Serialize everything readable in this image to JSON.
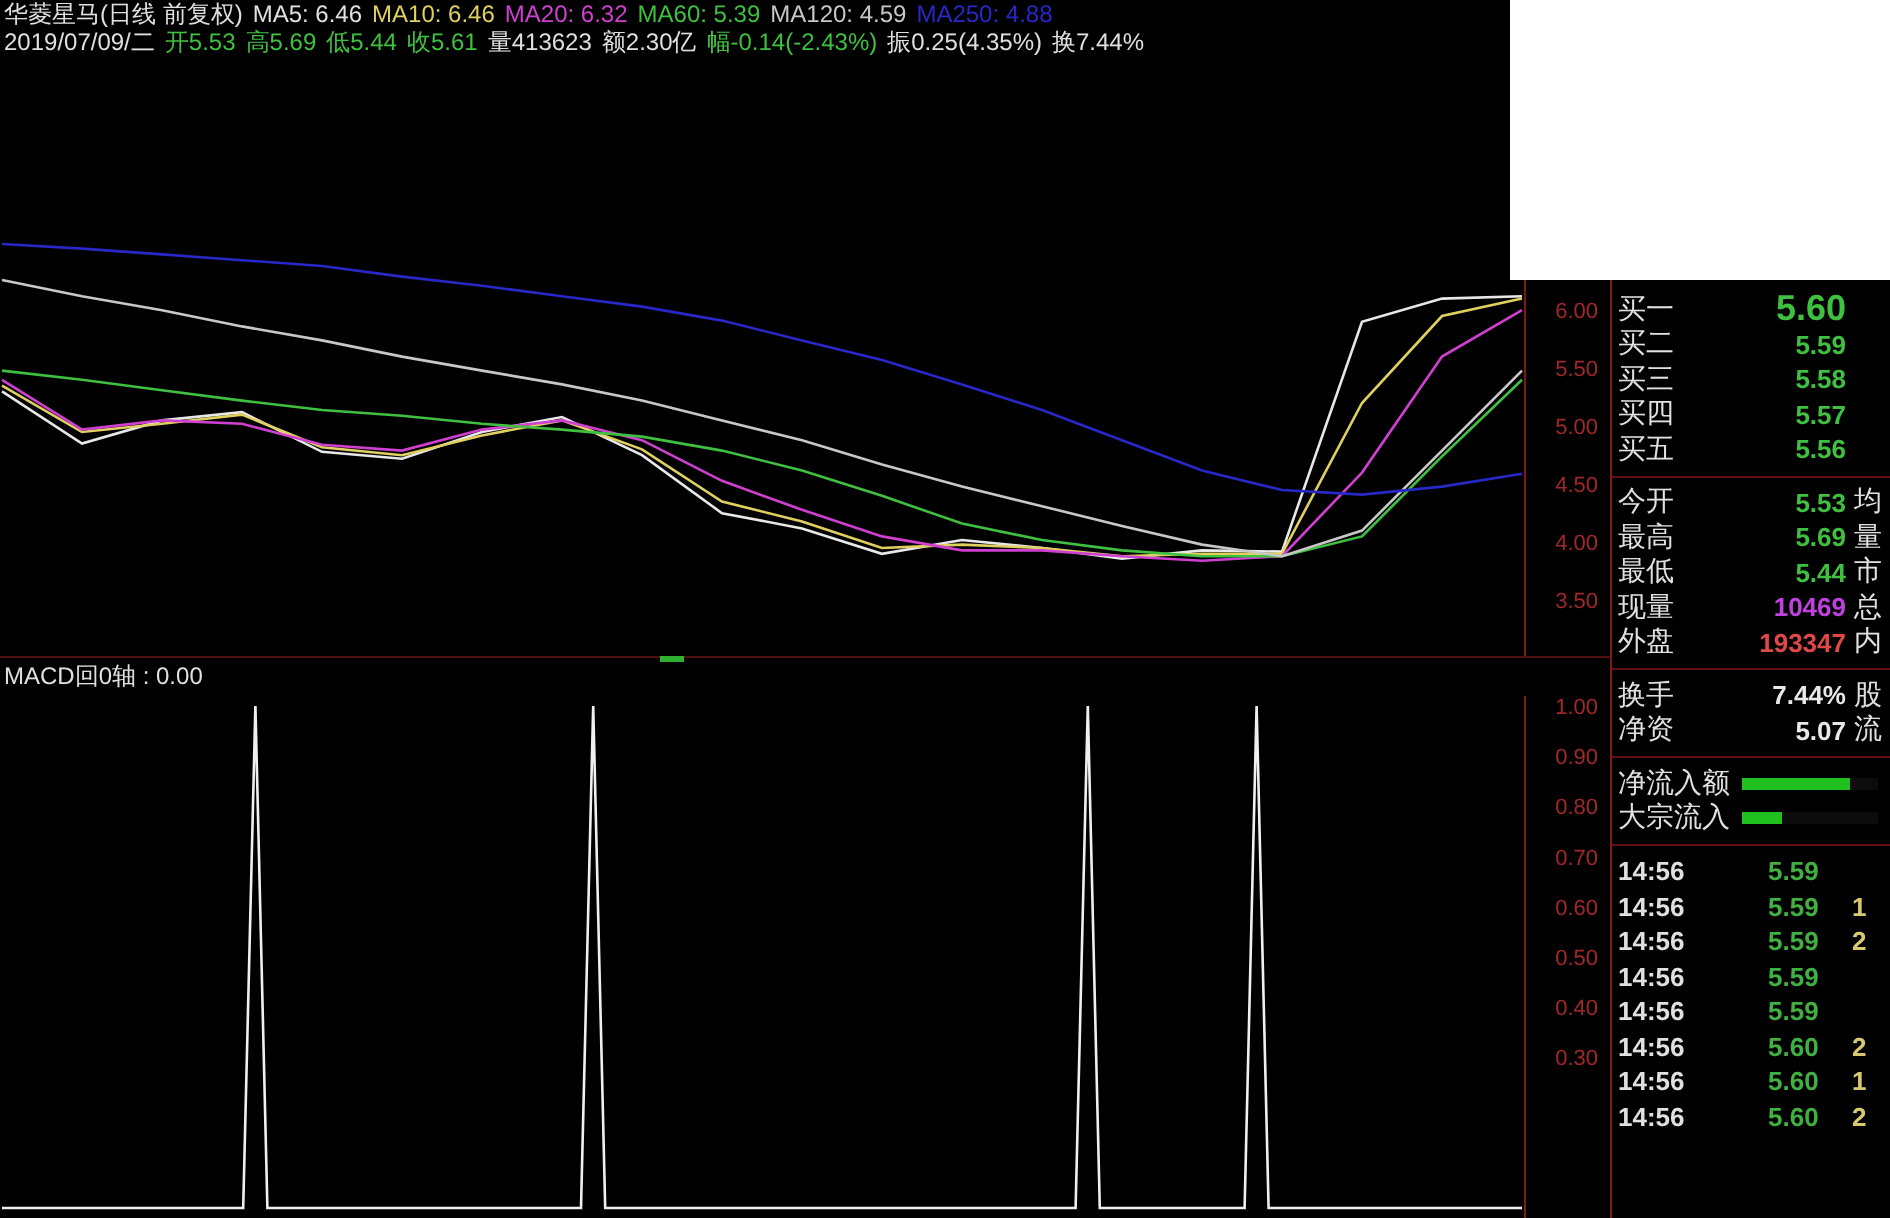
{
  "header": {
    "line1": [
      {
        "text": "华菱星马(日线 前复权)",
        "color": "#e0e0e0"
      },
      {
        "text": "MA5: 6.46",
        "color": "#e0e0e0"
      },
      {
        "text": "MA10: 6.46",
        "color": "#e0d060"
      },
      {
        "text": "MA20: 6.32",
        "color": "#d040d0"
      },
      {
        "text": "MA60: 5.39",
        "color": "#40c040"
      },
      {
        "text": "MA120: 4.59",
        "color": "#c8c8c8"
      },
      {
        "text": "MA250: 4.88",
        "color": "#2828c8"
      }
    ],
    "line2": [
      {
        "text": "2019/07/09/二",
        "color": "#e0e0e0"
      },
      {
        "text": "开5.53",
        "color": "#40c040"
      },
      {
        "text": "高5.69",
        "color": "#40c040"
      },
      {
        "text": "低5.44",
        "color": "#40c040"
      },
      {
        "text": "收5.61",
        "color": "#40c040"
      },
      {
        "text": "量413623",
        "color": "#e0e0e0"
      },
      {
        "text": "额2.30亿",
        "color": "#e0e0e0"
      },
      {
        "text": "幅-0.14(-2.43%)",
        "color": "#40c040"
      },
      {
        "text": "振0.25(4.35%)",
        "color": "#e0e0e0"
      },
      {
        "text": "换7.44%",
        "color": "#e0e0e0"
      }
    ]
  },
  "price_chart": {
    "chart_data": {
      "type": "line",
      "ylim": [
        3.02,
        8.19
      ],
      "yticks": [
        {
          "value": 3.5,
          "label": "3.50"
        },
        {
          "value": 4,
          "label": "4.00"
        },
        {
          "value": 4.5,
          "label": "4.50"
        },
        {
          "value": 5,
          "label": "5.00"
        },
        {
          "value": 5.5,
          "label": "5.50"
        },
        {
          "value": 6,
          "label": "6.00"
        }
      ],
      "series": [
        {
          "color": "#e8e8e8",
          "values": [
            5.3,
            4.85,
            5.05,
            5.12,
            4.78,
            4.72,
            4.95,
            5.08,
            4.75,
            4.25,
            4.12,
            3.9,
            4.02,
            3.95,
            3.86,
            3.93,
            3.92,
            5.9,
            6.1,
            6.12
          ]
        },
        {
          "color": "#e0d060",
          "values": [
            5.35,
            4.95,
            5.02,
            5.1,
            4.82,
            4.75,
            4.92,
            5.05,
            4.8,
            4.35,
            4.18,
            3.95,
            3.98,
            3.95,
            3.88,
            3.9,
            3.9,
            5.2,
            5.95,
            6.1
          ]
        },
        {
          "color": "#d040d0",
          "values": [
            5.4,
            4.97,
            5.05,
            5.02,
            4.84,
            4.79,
            4.97,
            5.05,
            4.88,
            4.53,
            4.28,
            4.05,
            3.93,
            3.93,
            3.88,
            3.84,
            3.88,
            4.6,
            5.6,
            6.0
          ]
        },
        {
          "color": "#40c040",
          "values": [
            5.48,
            5.4,
            5.31,
            5.22,
            5.14,
            5.09,
            5.02,
            4.97,
            4.91,
            4.79,
            4.62,
            4.4,
            4.16,
            4.02,
            3.93,
            3.88,
            3.88,
            4.05,
            4.74,
            5.4
          ]
        },
        {
          "color": "#c8c8c8",
          "values": [
            6.26,
            6.12,
            6.0,
            5.86,
            5.74,
            5.6,
            5.48,
            5.36,
            5.22,
            5.05,
            4.88,
            4.67,
            4.48,
            4.31,
            4.14,
            3.98,
            3.88,
            4.1,
            4.79,
            5.48
          ]
        },
        {
          "color": "#2828c8",
          "values": [
            6.57,
            6.53,
            6.48,
            6.43,
            6.38,
            6.29,
            6.21,
            6.12,
            6.03,
            5.91,
            5.74,
            5.57,
            5.36,
            5.14,
            4.88,
            4.62,
            4.45,
            4.41,
            4.48,
            4.59
          ]
        }
      ]
    }
  },
  "macd": {
    "title": "MACD回0轴 : 0.00",
    "chart_data": {
      "type": "line",
      "ylim": [
        -0.02,
        1.02
      ],
      "yticks": [
        {
          "value": 0.3,
          "label": "0.30"
        },
        {
          "value": 0.4,
          "label": "0.40"
        },
        {
          "value": 0.5,
          "label": "0.50"
        },
        {
          "value": 0.6,
          "label": "0.60"
        },
        {
          "value": 0.7,
          "label": "0.70"
        },
        {
          "value": 0.8,
          "label": "0.80"
        },
        {
          "value": 0.9,
          "label": "0.90"
        },
        {
          "value": 1,
          "label": "1.00"
        }
      ],
      "series": [
        {
          "color": "#f0f0f0",
          "values": [
            0,
            0,
            0,
            0,
            0,
            0,
            0,
            0,
            0,
            0,
            0,
            0,
            0,
            0,
            0,
            0,
            0,
            0,
            0,
            0,
            0,
            1,
            0,
            0,
            0,
            0,
            0,
            0,
            0,
            0,
            0,
            0,
            0,
            0,
            0,
            0,
            0,
            0,
            0,
            0,
            0,
            0,
            0,
            0,
            0,
            0,
            0,
            0,
            0,
            1,
            0,
            0,
            0,
            0,
            0,
            0,
            0,
            0,
            0,
            0,
            0,
            0,
            0,
            0,
            0,
            0,
            0,
            0,
            0,
            0,
            0,
            0,
            0,
            0,
            0,
            0,
            0,
            0,
            0,
            0,
            0,
            0,
            0,
            0,
            0,
            0,
            0,
            0,
            0,
            0,
            1,
            0,
            0,
            0,
            0,
            0,
            0,
            0,
            0,
            0,
            0,
            0,
            0,
            0,
            1,
            0,
            0,
            0,
            0,
            0,
            0,
            0,
            0,
            0,
            0,
            0,
            0,
            0,
            0,
            0,
            0,
            0,
            0,
            0,
            0,
            0,
            0
          ]
        }
      ]
    }
  },
  "order_book": [
    {
      "label": "买一",
      "price": "5.60"
    },
    {
      "label": "买二",
      "price": "5.59"
    },
    {
      "label": "买三",
      "price": "5.58"
    },
    {
      "label": "买四",
      "price": "5.57"
    },
    {
      "label": "买五",
      "price": "5.56"
    }
  ],
  "quote": [
    {
      "label": "今开",
      "value": "5.53",
      "color": "#40c040",
      "label2": "均"
    },
    {
      "label": "最高",
      "value": "5.69",
      "color": "#40c040",
      "label2": "量"
    },
    {
      "label": "最低",
      "value": "5.44",
      "color": "#40c040",
      "label2": "市"
    },
    {
      "label": "现量",
      "value": "10469",
      "color": "#c040e0",
      "label2": "总"
    },
    {
      "label": "外盘",
      "value": "193347",
      "color": "#e04848",
      "label2": "内"
    }
  ],
  "shares": [
    {
      "label": "换手",
      "value": "7.44%",
      "label2": "股"
    },
    {
      "label": "净资",
      "value": "5.07",
      "label2": "流"
    }
  ],
  "flows": [
    {
      "label": "净流入额",
      "level": 0.8
    },
    {
      "label": "大宗流入",
      "level": 0.3
    }
  ],
  "ticks": [
    {
      "time": "14:56",
      "price": "5.59"
    },
    {
      "time": "14:56",
      "price": "5.59",
      "volume": "1"
    },
    {
      "time": "14:56",
      "price": "5.59",
      "volume": "2"
    },
    {
      "time": "14:56",
      "price": "5.59"
    },
    {
      "time": "14:56",
      "price": "5.59"
    },
    {
      "time": "14:56",
      "price": "5.60",
      "volume": "2"
    },
    {
      "time": "14:56",
      "price": "5.60",
      "volume": "1"
    },
    {
      "time": "14:56",
      "price": "5.60",
      "volume": "2"
    }
  ]
}
